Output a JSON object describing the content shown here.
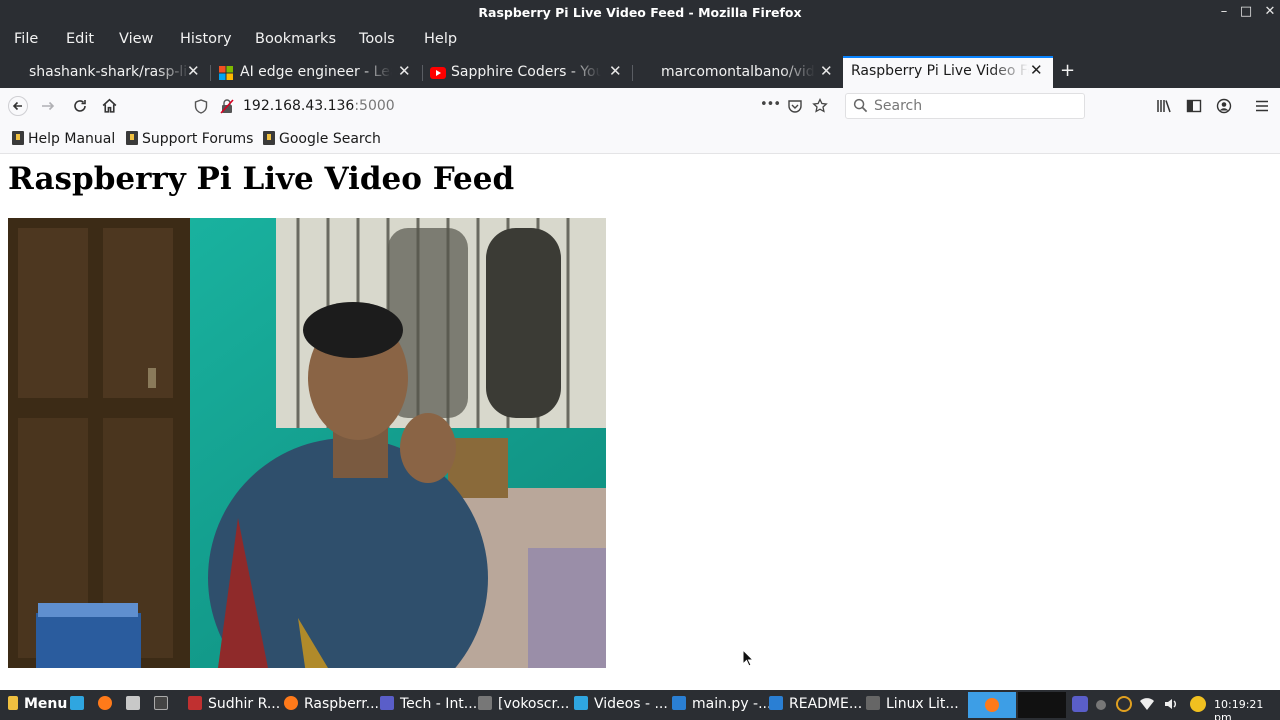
{
  "window": {
    "title": "Raspberry Pi Live Video Feed - Mozilla Firefox",
    "controls": {
      "minimize": "–",
      "maximize": "□",
      "close": "✕"
    }
  },
  "menubar": [
    "File",
    "Edit",
    "View",
    "History",
    "Bookmarks",
    "Tools",
    "Help"
  ],
  "tabs": [
    {
      "label": "shashank-shark/rasp-li",
      "close": "✕",
      "icon": "github-icon"
    },
    {
      "label": "AI edge engineer - Lear",
      "close": "✕",
      "icon": "microsoft-icon"
    },
    {
      "label": "Sapphire Coders - YouT",
      "close": "✕",
      "icon": "youtube-icon"
    },
    {
      "label": "marcomontalbano/vide",
      "close": "✕",
      "icon": "github-icon"
    },
    {
      "label": "Raspberry Pi Live Video Fe",
      "close": "✕",
      "active": true
    }
  ],
  "newtab": "+",
  "nav": {
    "url_host": "192.168.43.136",
    "url_port": ":5000",
    "search_placeholder": "Search",
    "page_actions": "•••"
  },
  "bookmarks": [
    "Help Manual",
    "Support Forums",
    "Google Search"
  ],
  "page": {
    "heading": "Raspberry Pi Live Video Feed"
  },
  "taskbar": {
    "menu": "Menu",
    "tasks": [
      "Sudhir R...",
      "Raspberr...",
      "Tech - Int...",
      "[vokoscr...",
      "Videos - ...",
      "main.py -...",
      "README...",
      "Linux Lit..."
    ],
    "clock": "10:19:21 pm"
  },
  "colors": {
    "chrome": "#2b2e33",
    "accent": "#0a84ff",
    "toolbar": "#f9f9fb",
    "video_wall": "#16a092"
  }
}
